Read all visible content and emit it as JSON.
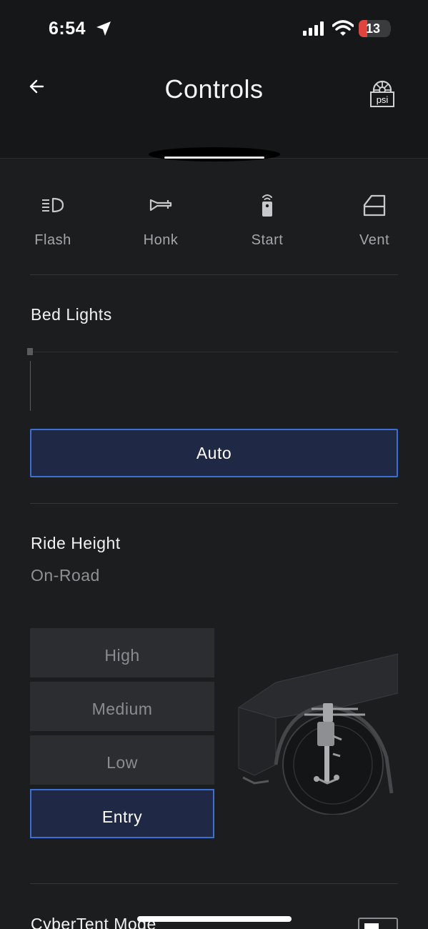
{
  "status_bar": {
    "time": "6:54",
    "battery_level": "13",
    "battery_color": "#e0443e"
  },
  "header": {
    "title": "Controls",
    "back_icon": "arrow-left-icon",
    "tire_pressure_icon": "tire-pressure-psi-icon",
    "tire_pressure_icon_text": "psi"
  },
  "quick_actions": [
    {
      "label": "Flash",
      "icon": "headlight-icon"
    },
    {
      "label": "Honk",
      "icon": "horn-icon"
    },
    {
      "label": "Start",
      "icon": "key-fob-icon"
    },
    {
      "label": "Vent",
      "icon": "window-icon"
    }
  ],
  "bed_lights": {
    "title": "Bed Lights",
    "brightness_percent": 0,
    "auto_label": "Auto",
    "auto_selected": true
  },
  "ride_height": {
    "title": "Ride Height",
    "current_mode": "On-Road",
    "options": [
      "High",
      "Medium",
      "Low",
      "Entry"
    ],
    "selected_option": "Entry"
  },
  "cybertent": {
    "title": "CyberTent Mode"
  },
  "colors": {
    "background": "#1c1d1f",
    "header_background": "#161718",
    "accent": "#3d6ed4",
    "selected_fill": "#1f2844",
    "option_fill": "#2c2d30"
  }
}
